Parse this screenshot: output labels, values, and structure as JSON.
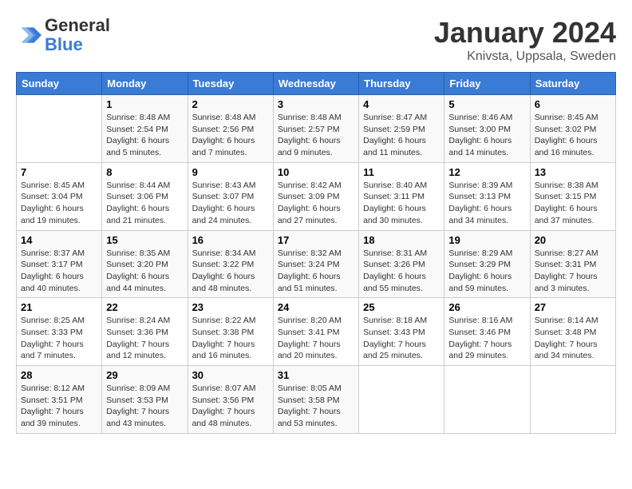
{
  "logo": {
    "line1": "General",
    "line2": "Blue"
  },
  "title": "January 2024",
  "subtitle": "Knivsta, Uppsala, Sweden",
  "days_of_week": [
    "Sunday",
    "Monday",
    "Tuesday",
    "Wednesday",
    "Thursday",
    "Friday",
    "Saturday"
  ],
  "weeks": [
    [
      {
        "num": "",
        "sunrise": "",
        "sunset": "",
        "daylight": ""
      },
      {
        "num": "1",
        "sunrise": "Sunrise: 8:48 AM",
        "sunset": "Sunset: 2:54 PM",
        "daylight": "Daylight: 6 hours and 5 minutes."
      },
      {
        "num": "2",
        "sunrise": "Sunrise: 8:48 AM",
        "sunset": "Sunset: 2:56 PM",
        "daylight": "Daylight: 6 hours and 7 minutes."
      },
      {
        "num": "3",
        "sunrise": "Sunrise: 8:48 AM",
        "sunset": "Sunset: 2:57 PM",
        "daylight": "Daylight: 6 hours and 9 minutes."
      },
      {
        "num": "4",
        "sunrise": "Sunrise: 8:47 AM",
        "sunset": "Sunset: 2:59 PM",
        "daylight": "Daylight: 6 hours and 11 minutes."
      },
      {
        "num": "5",
        "sunrise": "Sunrise: 8:46 AM",
        "sunset": "Sunset: 3:00 PM",
        "daylight": "Daylight: 6 hours and 14 minutes."
      },
      {
        "num": "6",
        "sunrise": "Sunrise: 8:45 AM",
        "sunset": "Sunset: 3:02 PM",
        "daylight": "Daylight: 6 hours and 16 minutes."
      }
    ],
    [
      {
        "num": "7",
        "sunrise": "Sunrise: 8:45 AM",
        "sunset": "Sunset: 3:04 PM",
        "daylight": "Daylight: 6 hours and 19 minutes."
      },
      {
        "num": "8",
        "sunrise": "Sunrise: 8:44 AM",
        "sunset": "Sunset: 3:06 PM",
        "daylight": "Daylight: 6 hours and 21 minutes."
      },
      {
        "num": "9",
        "sunrise": "Sunrise: 8:43 AM",
        "sunset": "Sunset: 3:07 PM",
        "daylight": "Daylight: 6 hours and 24 minutes."
      },
      {
        "num": "10",
        "sunrise": "Sunrise: 8:42 AM",
        "sunset": "Sunset: 3:09 PM",
        "daylight": "Daylight: 6 hours and 27 minutes."
      },
      {
        "num": "11",
        "sunrise": "Sunrise: 8:40 AM",
        "sunset": "Sunset: 3:11 PM",
        "daylight": "Daylight: 6 hours and 30 minutes."
      },
      {
        "num": "12",
        "sunrise": "Sunrise: 8:39 AM",
        "sunset": "Sunset: 3:13 PM",
        "daylight": "Daylight: 6 hours and 34 minutes."
      },
      {
        "num": "13",
        "sunrise": "Sunrise: 8:38 AM",
        "sunset": "Sunset: 3:15 PM",
        "daylight": "Daylight: 6 hours and 37 minutes."
      }
    ],
    [
      {
        "num": "14",
        "sunrise": "Sunrise: 8:37 AM",
        "sunset": "Sunset: 3:17 PM",
        "daylight": "Daylight: 6 hours and 40 minutes."
      },
      {
        "num": "15",
        "sunrise": "Sunrise: 8:35 AM",
        "sunset": "Sunset: 3:20 PM",
        "daylight": "Daylight: 6 hours and 44 minutes."
      },
      {
        "num": "16",
        "sunrise": "Sunrise: 8:34 AM",
        "sunset": "Sunset: 3:22 PM",
        "daylight": "Daylight: 6 hours and 48 minutes."
      },
      {
        "num": "17",
        "sunrise": "Sunrise: 8:32 AM",
        "sunset": "Sunset: 3:24 PM",
        "daylight": "Daylight: 6 hours and 51 minutes."
      },
      {
        "num": "18",
        "sunrise": "Sunrise: 8:31 AM",
        "sunset": "Sunset: 3:26 PM",
        "daylight": "Daylight: 6 hours and 55 minutes."
      },
      {
        "num": "19",
        "sunrise": "Sunrise: 8:29 AM",
        "sunset": "Sunset: 3:29 PM",
        "daylight": "Daylight: 6 hours and 59 minutes."
      },
      {
        "num": "20",
        "sunrise": "Sunrise: 8:27 AM",
        "sunset": "Sunset: 3:31 PM",
        "daylight": "Daylight: 7 hours and 3 minutes."
      }
    ],
    [
      {
        "num": "21",
        "sunrise": "Sunrise: 8:25 AM",
        "sunset": "Sunset: 3:33 PM",
        "daylight": "Daylight: 7 hours and 7 minutes."
      },
      {
        "num": "22",
        "sunrise": "Sunrise: 8:24 AM",
        "sunset": "Sunset: 3:36 PM",
        "daylight": "Daylight: 7 hours and 12 minutes."
      },
      {
        "num": "23",
        "sunrise": "Sunrise: 8:22 AM",
        "sunset": "Sunset: 3:38 PM",
        "daylight": "Daylight: 7 hours and 16 minutes."
      },
      {
        "num": "24",
        "sunrise": "Sunrise: 8:20 AM",
        "sunset": "Sunset: 3:41 PM",
        "daylight": "Daylight: 7 hours and 20 minutes."
      },
      {
        "num": "25",
        "sunrise": "Sunrise: 8:18 AM",
        "sunset": "Sunset: 3:43 PM",
        "daylight": "Daylight: 7 hours and 25 minutes."
      },
      {
        "num": "26",
        "sunrise": "Sunrise: 8:16 AM",
        "sunset": "Sunset: 3:46 PM",
        "daylight": "Daylight: 7 hours and 29 minutes."
      },
      {
        "num": "27",
        "sunrise": "Sunrise: 8:14 AM",
        "sunset": "Sunset: 3:48 PM",
        "daylight": "Daylight: 7 hours and 34 minutes."
      }
    ],
    [
      {
        "num": "28",
        "sunrise": "Sunrise: 8:12 AM",
        "sunset": "Sunset: 3:51 PM",
        "daylight": "Daylight: 7 hours and 39 minutes."
      },
      {
        "num": "29",
        "sunrise": "Sunrise: 8:09 AM",
        "sunset": "Sunset: 3:53 PM",
        "daylight": "Daylight: 7 hours and 43 minutes."
      },
      {
        "num": "30",
        "sunrise": "Sunrise: 8:07 AM",
        "sunset": "Sunset: 3:56 PM",
        "daylight": "Daylight: 7 hours and 48 minutes."
      },
      {
        "num": "31",
        "sunrise": "Sunrise: 8:05 AM",
        "sunset": "Sunset: 3:58 PM",
        "daylight": "Daylight: 7 hours and 53 minutes."
      },
      {
        "num": "",
        "sunrise": "",
        "sunset": "",
        "daylight": ""
      },
      {
        "num": "",
        "sunrise": "",
        "sunset": "",
        "daylight": ""
      },
      {
        "num": "",
        "sunrise": "",
        "sunset": "",
        "daylight": ""
      }
    ]
  ]
}
